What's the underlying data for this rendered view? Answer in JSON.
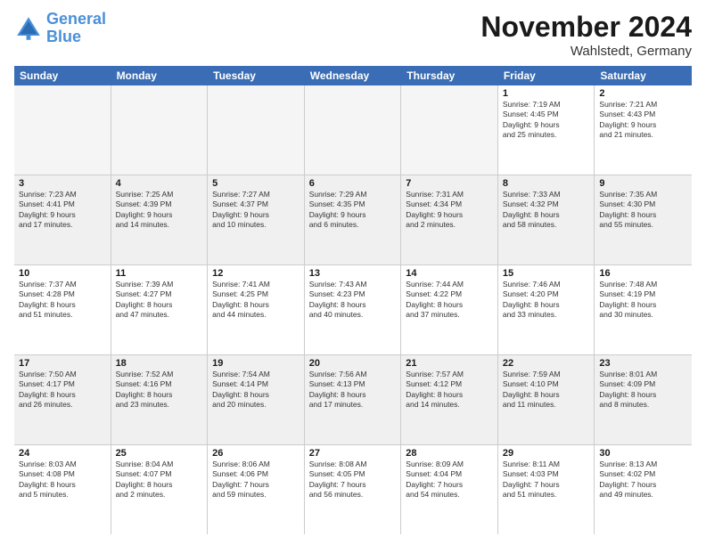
{
  "logo": {
    "text1": "General",
    "text2": "Blue"
  },
  "title": "November 2024",
  "subtitle": "Wahlstedt, Germany",
  "weekdays": [
    "Sunday",
    "Monday",
    "Tuesday",
    "Wednesday",
    "Thursday",
    "Friday",
    "Saturday"
  ],
  "rows": [
    [
      {
        "day": "",
        "info": "",
        "empty": true
      },
      {
        "day": "",
        "info": "",
        "empty": true
      },
      {
        "day": "",
        "info": "",
        "empty": true
      },
      {
        "day": "",
        "info": "",
        "empty": true
      },
      {
        "day": "",
        "info": "",
        "empty": true
      },
      {
        "day": "1",
        "info": "Sunrise: 7:19 AM\nSunset: 4:45 PM\nDaylight: 9 hours\nand 25 minutes."
      },
      {
        "day": "2",
        "info": "Sunrise: 7:21 AM\nSunset: 4:43 PM\nDaylight: 9 hours\nand 21 minutes."
      }
    ],
    [
      {
        "day": "3",
        "info": "Sunrise: 7:23 AM\nSunset: 4:41 PM\nDaylight: 9 hours\nand 17 minutes."
      },
      {
        "day": "4",
        "info": "Sunrise: 7:25 AM\nSunset: 4:39 PM\nDaylight: 9 hours\nand 14 minutes."
      },
      {
        "day": "5",
        "info": "Sunrise: 7:27 AM\nSunset: 4:37 PM\nDaylight: 9 hours\nand 10 minutes."
      },
      {
        "day": "6",
        "info": "Sunrise: 7:29 AM\nSunset: 4:35 PM\nDaylight: 9 hours\nand 6 minutes."
      },
      {
        "day": "7",
        "info": "Sunrise: 7:31 AM\nSunset: 4:34 PM\nDaylight: 9 hours\nand 2 minutes."
      },
      {
        "day": "8",
        "info": "Sunrise: 7:33 AM\nSunset: 4:32 PM\nDaylight: 8 hours\nand 58 minutes."
      },
      {
        "day": "9",
        "info": "Sunrise: 7:35 AM\nSunset: 4:30 PM\nDaylight: 8 hours\nand 55 minutes."
      }
    ],
    [
      {
        "day": "10",
        "info": "Sunrise: 7:37 AM\nSunset: 4:28 PM\nDaylight: 8 hours\nand 51 minutes."
      },
      {
        "day": "11",
        "info": "Sunrise: 7:39 AM\nSunset: 4:27 PM\nDaylight: 8 hours\nand 47 minutes."
      },
      {
        "day": "12",
        "info": "Sunrise: 7:41 AM\nSunset: 4:25 PM\nDaylight: 8 hours\nand 44 minutes."
      },
      {
        "day": "13",
        "info": "Sunrise: 7:43 AM\nSunset: 4:23 PM\nDaylight: 8 hours\nand 40 minutes."
      },
      {
        "day": "14",
        "info": "Sunrise: 7:44 AM\nSunset: 4:22 PM\nDaylight: 8 hours\nand 37 minutes."
      },
      {
        "day": "15",
        "info": "Sunrise: 7:46 AM\nSunset: 4:20 PM\nDaylight: 8 hours\nand 33 minutes."
      },
      {
        "day": "16",
        "info": "Sunrise: 7:48 AM\nSunset: 4:19 PM\nDaylight: 8 hours\nand 30 minutes."
      }
    ],
    [
      {
        "day": "17",
        "info": "Sunrise: 7:50 AM\nSunset: 4:17 PM\nDaylight: 8 hours\nand 26 minutes."
      },
      {
        "day": "18",
        "info": "Sunrise: 7:52 AM\nSunset: 4:16 PM\nDaylight: 8 hours\nand 23 minutes."
      },
      {
        "day": "19",
        "info": "Sunrise: 7:54 AM\nSunset: 4:14 PM\nDaylight: 8 hours\nand 20 minutes."
      },
      {
        "day": "20",
        "info": "Sunrise: 7:56 AM\nSunset: 4:13 PM\nDaylight: 8 hours\nand 17 minutes."
      },
      {
        "day": "21",
        "info": "Sunrise: 7:57 AM\nSunset: 4:12 PM\nDaylight: 8 hours\nand 14 minutes."
      },
      {
        "day": "22",
        "info": "Sunrise: 7:59 AM\nSunset: 4:10 PM\nDaylight: 8 hours\nand 11 minutes."
      },
      {
        "day": "23",
        "info": "Sunrise: 8:01 AM\nSunset: 4:09 PM\nDaylight: 8 hours\nand 8 minutes."
      }
    ],
    [
      {
        "day": "24",
        "info": "Sunrise: 8:03 AM\nSunset: 4:08 PM\nDaylight: 8 hours\nand 5 minutes."
      },
      {
        "day": "25",
        "info": "Sunrise: 8:04 AM\nSunset: 4:07 PM\nDaylight: 8 hours\nand 2 minutes."
      },
      {
        "day": "26",
        "info": "Sunrise: 8:06 AM\nSunset: 4:06 PM\nDaylight: 7 hours\nand 59 minutes."
      },
      {
        "day": "27",
        "info": "Sunrise: 8:08 AM\nSunset: 4:05 PM\nDaylight: 7 hours\nand 56 minutes."
      },
      {
        "day": "28",
        "info": "Sunrise: 8:09 AM\nSunset: 4:04 PM\nDaylight: 7 hours\nand 54 minutes."
      },
      {
        "day": "29",
        "info": "Sunrise: 8:11 AM\nSunset: 4:03 PM\nDaylight: 7 hours\nand 51 minutes."
      },
      {
        "day": "30",
        "info": "Sunrise: 8:13 AM\nSunset: 4:02 PM\nDaylight: 7 hours\nand 49 minutes."
      }
    ]
  ]
}
